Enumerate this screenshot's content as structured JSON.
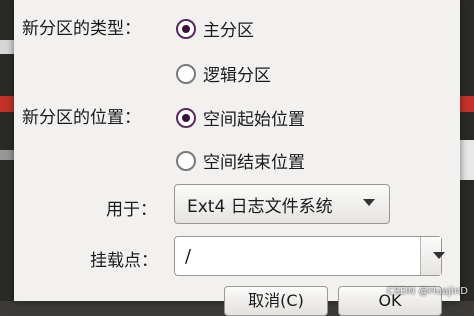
{
  "dialog": {
    "partition_type": {
      "label": "新分区的类型：",
      "options": [
        "主分区",
        "逻辑分区"
      ],
      "selected": "主分区"
    },
    "partition_position": {
      "label": "新分区的位置：",
      "options": [
        "空间起始位置",
        "空间结束位置"
      ],
      "selected": "空间起始位置"
    },
    "use_as": {
      "label": "用于：",
      "value": "Ext4 日志文件系统"
    },
    "mount_point": {
      "label": "挂载点：",
      "value": "/"
    },
    "buttons": {
      "cancel": "取消(C)",
      "ok": "OK"
    }
  },
  "watermark": "CSDN @HuajinD",
  "colors": {
    "dialog_bg": "#f2f1f0",
    "radio_selected": "#3a0f3a",
    "background_dark": "#3c3b37",
    "accent_red": "#c8312b"
  }
}
